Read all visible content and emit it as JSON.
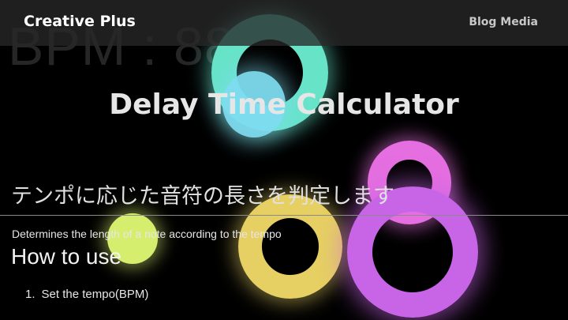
{
  "header": {
    "brand": "Creative Plus",
    "nav_link": "Blog Media"
  },
  "background": {
    "bpm_text": "BPM : 88"
  },
  "main": {
    "title": "Delay Time Calculator",
    "subtitle_jp": "テンポに応じた音符の長さを判定します",
    "description": "Determines the length of a note according to the tempo",
    "how_to_use": {
      "heading": "How to use",
      "steps": [
        {
          "number": "1.",
          "text": "Set the tempo(BPM)"
        }
      ]
    }
  },
  "colors": {
    "ring_teal": "#67e3c8",
    "ring_cyan": "#7fdcf0",
    "ring_magenta": "#e56fe0",
    "ring_yellow": "#e6cf63",
    "ring_purple": "#c865e6",
    "ring_lime": "#d6ee6d",
    "header_bg": "#282828",
    "page_bg": "#000000"
  }
}
